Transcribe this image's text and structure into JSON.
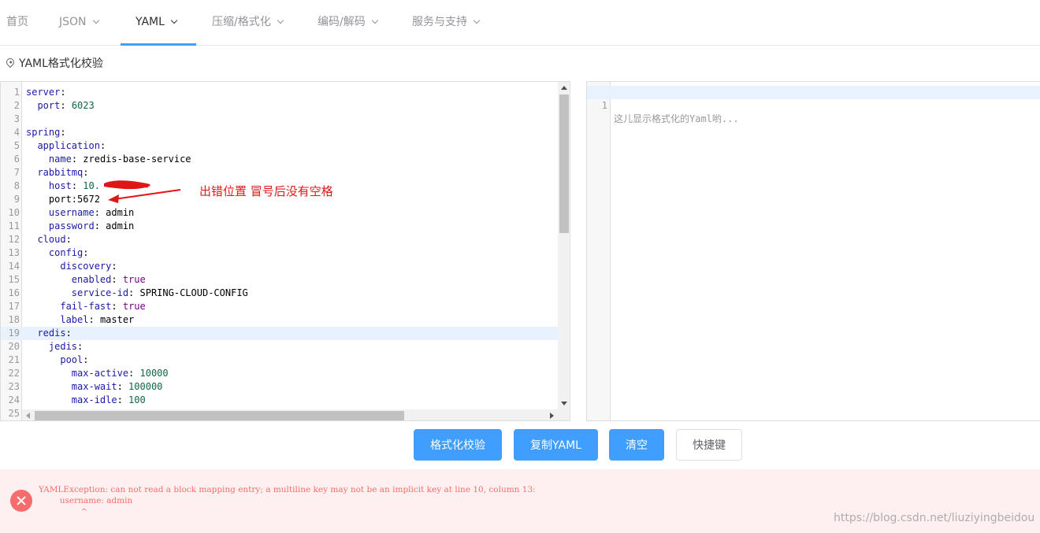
{
  "nav": {
    "items": [
      {
        "label": "首页",
        "dropdown": false,
        "active": false
      },
      {
        "label": "JSON",
        "dropdown": true,
        "active": false
      },
      {
        "label": "YAML",
        "dropdown": true,
        "active": true
      },
      {
        "label": "压缩/格式化",
        "dropdown": true,
        "active": false
      },
      {
        "label": "编码/解码",
        "dropdown": true,
        "active": false
      },
      {
        "label": "服务与支持",
        "dropdown": true,
        "active": false
      }
    ]
  },
  "section": {
    "title": "YAML格式化校验",
    "icon": "location-pin-icon"
  },
  "input_editor": {
    "line_numbers": [
      "1",
      "2",
      "3",
      "4",
      "5",
      "6",
      "7",
      "8",
      "9",
      "10",
      "11",
      "12",
      "13",
      "14",
      "15",
      "16",
      "17",
      "18",
      "19",
      "20",
      "21",
      "22",
      "23",
      "24",
      "25"
    ],
    "active_line": 19,
    "lines": [
      {
        "indent": "",
        "key": "server",
        "sep": ":",
        "value": "",
        "vtype": ""
      },
      {
        "indent": "  ",
        "key": "port",
        "sep": ": ",
        "value": "6023",
        "vtype": "n"
      },
      {
        "indent": "",
        "key": "",
        "sep": "",
        "value": "",
        "vtype": ""
      },
      {
        "indent": "",
        "key": "spring",
        "sep": ":",
        "value": "",
        "vtype": ""
      },
      {
        "indent": "  ",
        "key": "application",
        "sep": ":",
        "value": "",
        "vtype": ""
      },
      {
        "indent": "    ",
        "key": "name",
        "sep": ": ",
        "value": "zredis-base-service",
        "vtype": "v"
      },
      {
        "indent": "  ",
        "key": "rabbitmq",
        "sep": ":",
        "value": "",
        "vtype": ""
      },
      {
        "indent": "    ",
        "key": "host",
        "sep": ": ",
        "value": "10.",
        "vtype": "n"
      },
      {
        "indent": "    ",
        "key": "",
        "sep": "",
        "value": "port:5672",
        "vtype": "v"
      },
      {
        "indent": "    ",
        "key": "username",
        "sep": ": ",
        "value": "admin",
        "vtype": "v"
      },
      {
        "indent": "    ",
        "key": "password",
        "sep": ": ",
        "value": "admin",
        "vtype": "v"
      },
      {
        "indent": "  ",
        "key": "cloud",
        "sep": ":",
        "value": "",
        "vtype": ""
      },
      {
        "indent": "    ",
        "key": "config",
        "sep": ":",
        "value": "",
        "vtype": ""
      },
      {
        "indent": "      ",
        "key": "discovery",
        "sep": ":",
        "value": "",
        "vtype": ""
      },
      {
        "indent": "        ",
        "key": "enabled",
        "sep": ": ",
        "value": "true",
        "vtype": "b"
      },
      {
        "indent": "        ",
        "key": "service-id",
        "sep": ": ",
        "value": "SPRING-CLOUD-CONFIG",
        "vtype": "v"
      },
      {
        "indent": "      ",
        "key": "fail-fast",
        "sep": ": ",
        "value": "true",
        "vtype": "b"
      },
      {
        "indent": "      ",
        "key": "label",
        "sep": ": ",
        "value": "master",
        "vtype": "v"
      },
      {
        "indent": "  ",
        "key": "redis",
        "sep": ":",
        "value": "",
        "vtype": ""
      },
      {
        "indent": "    ",
        "key": "jedis",
        "sep": ":",
        "value": "",
        "vtype": ""
      },
      {
        "indent": "      ",
        "key": "pool",
        "sep": ":",
        "value": "",
        "vtype": ""
      },
      {
        "indent": "        ",
        "key": "max-active",
        "sep": ": ",
        "value": "10000",
        "vtype": "n"
      },
      {
        "indent": "        ",
        "key": "max-wait",
        "sep": ": ",
        "value": "100000",
        "vtype": "n"
      },
      {
        "indent": "        ",
        "key": "max-idle",
        "sep": ": ",
        "value": "100",
        "vtype": "n"
      },
      {
        "indent": "",
        "key": "",
        "sep": "",
        "value": "",
        "vtype": ""
      }
    ]
  },
  "output_editor": {
    "line_number": "1",
    "placeholder": "这儿显示格式化的Yaml哟..."
  },
  "annotation": {
    "text": "出错位置  冒号后没有空格",
    "color": "#e0191a"
  },
  "buttons": {
    "format": "格式化校验",
    "copy": "复制YAML",
    "clear": "清空",
    "shortcuts": "快捷键"
  },
  "error": {
    "text": "YAMLException: can not read a block mapping entry; a multiline key may not be an implicit key at line 10, column 13:\n        username: admin\n                ^",
    "icon": "close-circle-icon"
  },
  "watermark": "https://blog.csdn.net/liuziyingbeidou",
  "colors": {
    "accent": "#409eff",
    "error": "#f56c6c",
    "error_bg": "#fef0f0"
  }
}
